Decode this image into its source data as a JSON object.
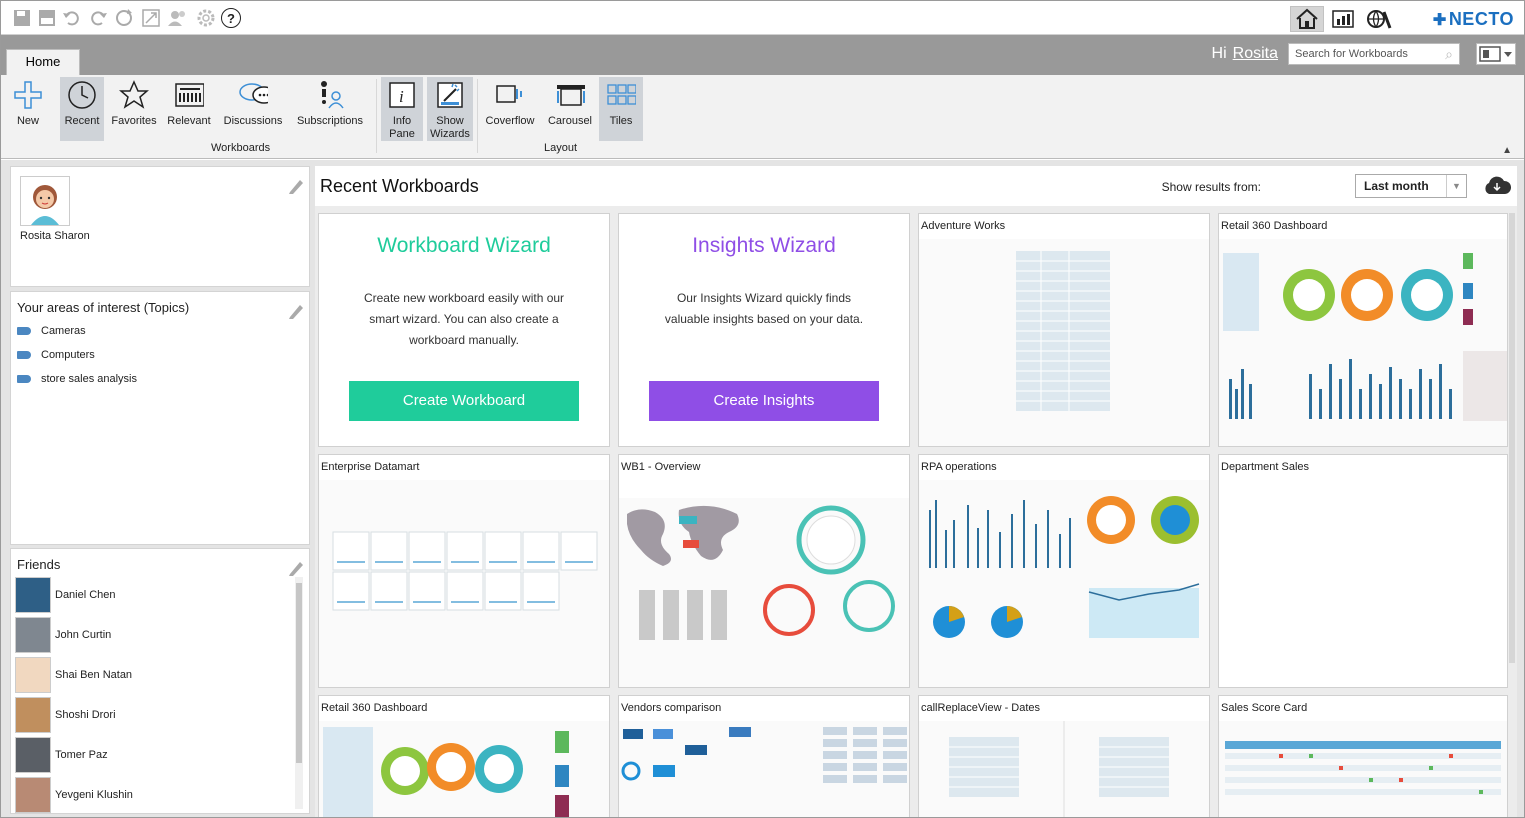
{
  "app": {
    "brand": "NECTO",
    "colors": {
      "accent": "#1b6fc0",
      "teal": "#1fcc9b",
      "purple": "#8f4ee6"
    }
  },
  "quick_access": [
    "save-icon",
    "save-as-icon",
    "undo-icon",
    "redo-icon",
    "refresh-icon",
    "fullscreen-icon",
    "users-icon",
    "settings-icon",
    "help-icon"
  ],
  "quick_help_glyph": "?",
  "home_tab": "Home",
  "greeting": {
    "hi": "Hi",
    "user": "Rosita"
  },
  "search": {
    "placeholder": "Search for Workboards"
  },
  "ribbon": {
    "new": "New",
    "recent": "Recent",
    "favorites": "Favorites",
    "relevant": "Relevant",
    "discussions": "Discussions",
    "subscriptions": "Subscriptions",
    "group_workboards": "Workboards",
    "info_pane": "Info Pane",
    "show_wizards": "Show Wizards",
    "coverflow": "Coverflow",
    "carousel": "Carousel",
    "tiles": "Tiles",
    "group_layout": "Layout"
  },
  "profile": {
    "name": "Rosita Sharon"
  },
  "topics": {
    "title": "Your areas of interest (Topics)",
    "items": [
      "Cameras",
      "Computers",
      "store sales analysis"
    ]
  },
  "friends": {
    "title": "Friends",
    "items": [
      "Daniel Chen",
      "John Curtin",
      "Shai Ben Natan",
      "Shoshi Drori",
      "Tomer Paz",
      "Yevgeni Klushin"
    ]
  },
  "content": {
    "title": "Recent Workboards",
    "show_results_label": "Show results from:",
    "period": "Last month",
    "workboard_wizard": {
      "title": "Workboard Wizard",
      "text": "Create new workboard easily with our smart wizard. You can also create a workboard manually.",
      "button": "Create Workboard"
    },
    "insights_wizard": {
      "title": "Insights Wizard",
      "text": "Our Insights Wizard quickly finds valuable insights based on your data.",
      "button": "Create Insights"
    },
    "tiles": [
      "Adventure Works",
      "Retail 360 Dashboard",
      "Enterprise Datamart",
      "WB1 - Overview",
      "RPA operations",
      "Department Sales",
      "Retail 360 Dashboard",
      "Vendors comparison",
      "callReplaceView - Dates",
      "Sales Score Card"
    ]
  }
}
